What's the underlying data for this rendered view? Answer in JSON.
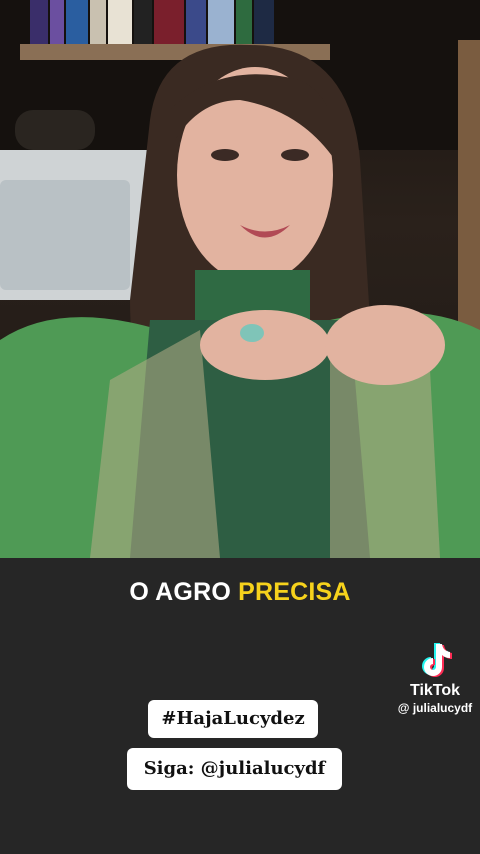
{
  "caption": {
    "part1": "O AGRO",
    "part2": "PRECISA"
  },
  "watermark": {
    "brand": "TikTok",
    "handle": "@ julialucydf"
  },
  "tags": {
    "hashtag": "#HajaLucydez",
    "follow": "Siga: @julialucydf"
  },
  "colors": {
    "caption_highlight": "#f6d21c",
    "background": "#262626",
    "sweater": "#2e7d46"
  },
  "icons": {
    "tiktok": "tiktok-logo-icon"
  }
}
